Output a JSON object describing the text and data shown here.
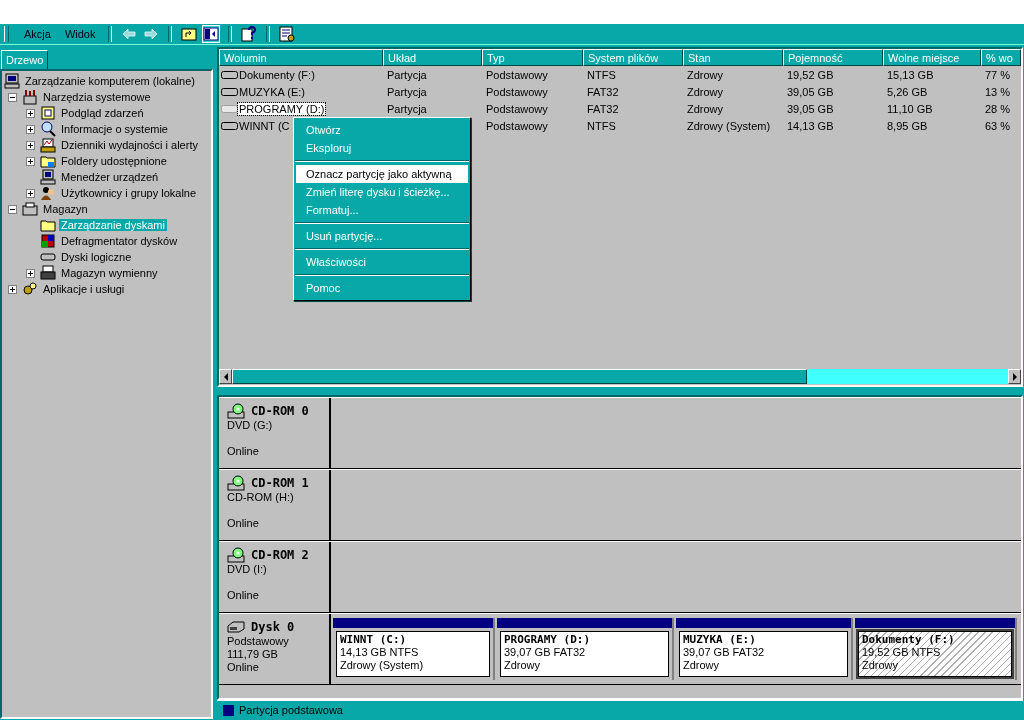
{
  "toolbar": {
    "menus": [
      "Akcja",
      "Widok"
    ],
    "buttons": [
      {
        "kind": "back",
        "pressed": false
      },
      {
        "kind": "forward",
        "pressed": false
      },
      {
        "kind": "up",
        "pressed": false
      },
      {
        "kind": "tree",
        "pressed": true
      },
      {
        "kind": "help",
        "pressed": false
      },
      {
        "kind": "props",
        "pressed": false
      }
    ]
  },
  "tree_tab": "Drzewo",
  "tree": [
    {
      "label": "Zarządzanie komputerem (lokalne)",
      "selected": false,
      "children": [
        {
          "label": "Narzędzia systemowe",
          "expanded": true,
          "selected": false,
          "children": [
            {
              "label": "Podgląd zdarzeń",
              "expanded": false,
              "selected": false
            },
            {
              "label": "Informacje o systemie",
              "expanded": false,
              "selected": false
            },
            {
              "label": "Dzienniki wydajności i alerty",
              "expanded": false,
              "selected": false
            },
            {
              "label": "Foldery udostępnione",
              "expanded": false,
              "selected": false
            },
            {
              "label": "Menedżer urządzeń",
              "selected": false
            },
            {
              "label": "Użytkownicy i grupy lokalne",
              "expanded": false,
              "selected": false
            }
          ]
        },
        {
          "label": "Magazyn",
          "expanded": true,
          "selected": false,
          "children": [
            {
              "label": "Zarządzanie dyskami",
              "selected": true
            },
            {
              "label": "Defragmentator dysków",
              "selected": false
            },
            {
              "label": "Dyski logiczne",
              "selected": false
            },
            {
              "label": "Magazyn wymienny",
              "expanded": false,
              "selected": false
            }
          ]
        },
        {
          "label": "Aplikacje i usługi",
          "expanded": false,
          "selected": false
        }
      ]
    }
  ],
  "table": {
    "columns": [
      "Wolumin",
      "Układ",
      "Typ",
      "System plików",
      "Stan",
      "Pojemność",
      "Wolne miejsce",
      "% wo"
    ],
    "rows": [
      {
        "selected": false,
        "cells": [
          "Dokumenty (F:)",
          "Partycja",
          "Podstawowy",
          "NTFS",
          "Zdrowy",
          "19,52 GB",
          "15,13 GB",
          "77 %"
        ]
      },
      {
        "selected": false,
        "cells": [
          "MUZYKA (E:)",
          "Partycja",
          "Podstawowy",
          "FAT32",
          "Zdrowy",
          "39,05 GB",
          "5,26 GB",
          "13 %"
        ]
      },
      {
        "selected": true,
        "cells": [
          "PROGRAMY (D:)",
          "Partycja",
          "Podstawowy",
          "FAT32",
          "Zdrowy",
          "39,05 GB",
          "11,10 GB",
          "28 %"
        ]
      },
      {
        "selected": false,
        "cells": [
          "WINNT (C",
          null,
          "Podstawowy",
          "NTFS",
          "Zdrowy (System)",
          "14,13 GB",
          "8,95 GB",
          "63 %"
        ]
      }
    ]
  },
  "context_menu": [
    [
      {
        "label": "Otwórz",
        "selected": false
      },
      {
        "label": "Eksploruj",
        "selected": false
      }
    ],
    [
      {
        "label": "Oznacz partycję jako aktywną",
        "selected": true
      },
      {
        "label": "Zmień literę dysku i ścieżkę...",
        "selected": false
      },
      {
        "label": "Formatuj...",
        "selected": false
      }
    ],
    [
      {
        "label": "Usuń partycję...",
        "selected": false
      }
    ],
    [
      {
        "label": "Właściwości",
        "selected": false
      }
    ],
    [
      {
        "label": "Pomoc",
        "selected": false
      }
    ]
  ],
  "disks": [
    {
      "kind": "cdrom",
      "name": "CD-ROM 0",
      "lines": [
        "DVD (G:)",
        "Online"
      ]
    },
    {
      "kind": "cdrom",
      "name": "CD-ROM 1",
      "lines": [
        "CD-ROM (H:)",
        "Online"
      ]
    },
    {
      "kind": "cdrom",
      "name": "CD-ROM 2",
      "lines": [
        "DVD (I:)",
        "Online"
      ]
    },
    {
      "kind": "disk",
      "name": "Dysk 0",
      "lines": [
        "Podstawowy",
        "111,79 GB",
        "Online"
      ],
      "partitions": [
        {
          "title": "WINNT  (C:)",
          "size": "14,13 GB NTFS",
          "status": "Zdrowy (System)",
          "selected": false
        },
        {
          "title": "PROGRAMY  (D:)",
          "size": "39,07 GB FAT32",
          "status": "Zdrowy",
          "selected": false
        },
        {
          "title": "MUZYKA  (E:)",
          "size": "39,07 GB FAT32",
          "status": "Zdrowy",
          "selected": false
        },
        {
          "title": "Dokumenty  (F:)",
          "size": "19,52 GB NTFS",
          "status": "Zdrowy",
          "selected": true
        }
      ]
    }
  ],
  "legend": [
    {
      "label": "Partycja podstawowa",
      "color": "#000080"
    }
  ]
}
